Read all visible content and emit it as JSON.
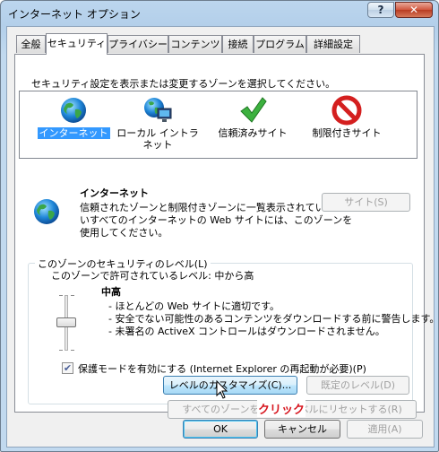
{
  "window": {
    "title": "インターネット オプション",
    "help_label": "?",
    "close_label": "✕"
  },
  "tabs": [
    {
      "label": "全般"
    },
    {
      "label": "セキュリティ"
    },
    {
      "label": "プライバシー"
    },
    {
      "label": "コンテンツ"
    },
    {
      "label": "接続"
    },
    {
      "label": "プログラム"
    },
    {
      "label": "詳細設定"
    }
  ],
  "active_tab": "セキュリティ",
  "security": {
    "instruction": "セキュリティ設定を表示または変更するゾーンを選択してください。",
    "zones": [
      {
        "label": "インターネット",
        "icon": "globe-icon",
        "selected": true
      },
      {
        "label": "ローカル イントラネット",
        "icon": "intranet-icon",
        "selected": false
      },
      {
        "label": "信頼済みサイト",
        "icon": "checkmark-icon",
        "selected": false
      },
      {
        "label": "制限付きサイト",
        "icon": "restricted-icon",
        "selected": false
      }
    ],
    "zone_name": "インターネット",
    "zone_desc_1": "信頼されたゾーンと制限付きゾーンに一覧表示されていな",
    "zone_desc_2": "いすべてのインターネットの Web サイトには、このゾーンを",
    "zone_desc_3": "使用してください。",
    "sites_button": "サイト(S)",
    "level_group_title": "このゾーンのセキュリティのレベル(L)",
    "allowed_levels": "このゾーンで許可されているレベル: 中から高",
    "level_name": "中高",
    "level_bullets": [
      "- ほとんどの Web サイトに適切です。",
      "- 安全でない可能性のあるコンテンツをダウンロードする前に警告します。",
      "- 未署名の ActiveX コントロールはダウンロードされません。"
    ],
    "protected_mode_label": "保護モードを有効にする (Internet Explorer の再起動が必要)(P)",
    "protected_mode_checked": true,
    "custom_level_button": "レベルのカスタマイズ(C)...",
    "default_level_button": "既定のレベル(D)",
    "reset_all_button": "すべてのゾーンを既定のレベルにリセットする(R)"
  },
  "annotation": {
    "click_label": "クリック",
    "color": "#d7161f"
  },
  "footer": {
    "ok": "OK",
    "cancel": "キャンセル",
    "apply": "適用(A)"
  },
  "colors": {
    "selection": "#3399ff",
    "title_bar": "#bcd6ee",
    "close_button": "#c9462c"
  }
}
